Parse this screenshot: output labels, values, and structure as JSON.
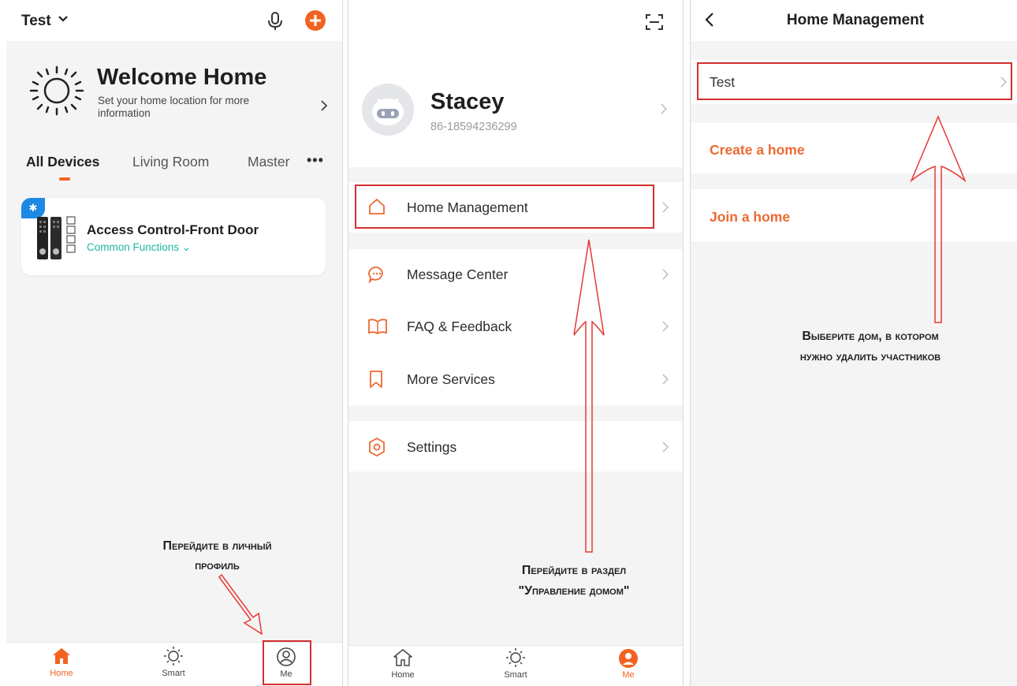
{
  "screen_home": {
    "home_name": "Test",
    "welcome_title": "Welcome Home",
    "location_prompt": "Set your home location for more information",
    "tabs": [
      {
        "label": "All Devices",
        "active": true
      },
      {
        "label": "Living Room",
        "active": false
      },
      {
        "label": "Master",
        "active": false
      }
    ],
    "more_label": "•••",
    "device": {
      "name": "Access Control-Front Door",
      "functions_label": "Common Functions ⌄",
      "connection_icon": "bluetooth-icon"
    },
    "annotation_line1": "Перейдите в личный",
    "annotation_line2": "профиль",
    "tabbar": [
      {
        "label": "Home",
        "icon": "home-icon",
        "active": true
      },
      {
        "label": "Smart",
        "icon": "sun-icon",
        "active": false
      },
      {
        "label": "Me",
        "icon": "profile-icon",
        "active": false
      }
    ]
  },
  "screen_me": {
    "user_name": "Stacey",
    "user_phone": "86-18594236299",
    "menu": [
      {
        "label": "Home Management",
        "icon": "house-outline-icon"
      },
      {
        "label": "Message Center",
        "icon": "chat-bubble-icon"
      },
      {
        "label": "FAQ & Feedback",
        "icon": "book-icon"
      },
      {
        "label": "More Services",
        "icon": "bookmark-icon"
      },
      {
        "label": "Settings",
        "icon": "hexagon-gear-icon"
      }
    ],
    "annotation_line1": "Перейдите в раздел",
    "annotation_line2": "\"Управление домом\"",
    "tabbar": [
      {
        "label": "Home",
        "icon": "home-icon",
        "active": false
      },
      {
        "label": "Smart",
        "icon": "sun-icon",
        "active": false
      },
      {
        "label": "Me",
        "icon": "profile-icon",
        "active": true
      }
    ]
  },
  "screen_home_management": {
    "title": "Home Management",
    "homes": [
      {
        "label": "Test"
      }
    ],
    "create_label": "Create a home",
    "join_label": "Join a home",
    "annotation_line1": "Выберите дом, в котором",
    "annotation_line2": "нужно удалить участников"
  },
  "colors": {
    "accent": "#f26322",
    "highlight_box": "#d32f2f",
    "teal": "#1fb6a6",
    "bluetooth": "#1e88e5",
    "annotation_arrow": "#e53935"
  }
}
